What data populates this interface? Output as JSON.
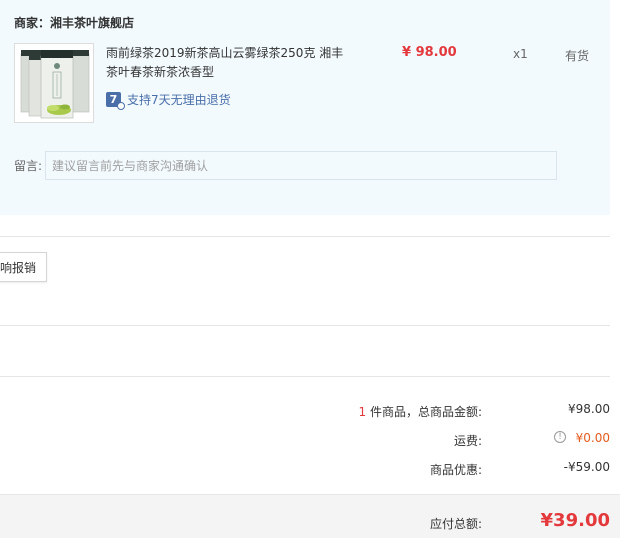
{
  "merchant": {
    "label": "商家：",
    "name": "湘丰茶叶旗舰店"
  },
  "product": {
    "title": "雨前绿茶2019新茶高山云雾绿茶250克 湘丰茶叶春茶新茶浓香型",
    "return_icon_glyph": "7",
    "return_policy": "支持7天无理由退货",
    "price": "¥ 98.00",
    "quantity": "x1",
    "stock_status": "有货"
  },
  "remark": {
    "label": "留言:",
    "placeholder": "建议留言前先与商家沟通确认"
  },
  "invoice": {
    "button_label": "响报销"
  },
  "summary": {
    "item_count": "1",
    "goods_total_label": "件商品，总商品金额:",
    "goods_total_value": "¥98.00",
    "shipping_label": "运费:",
    "shipping_value": "¥0.00",
    "discount_label": "商品优惠:",
    "discount_value": "-¥59.00",
    "payable_label": "应付总额:",
    "payable_value": "¥39.00"
  },
  "colors": {
    "price_red": "#e4393c",
    "shipping_orange": "#e45b1f",
    "panel_bg": "#f2fafe",
    "link_blue": "#4a6ea8"
  }
}
